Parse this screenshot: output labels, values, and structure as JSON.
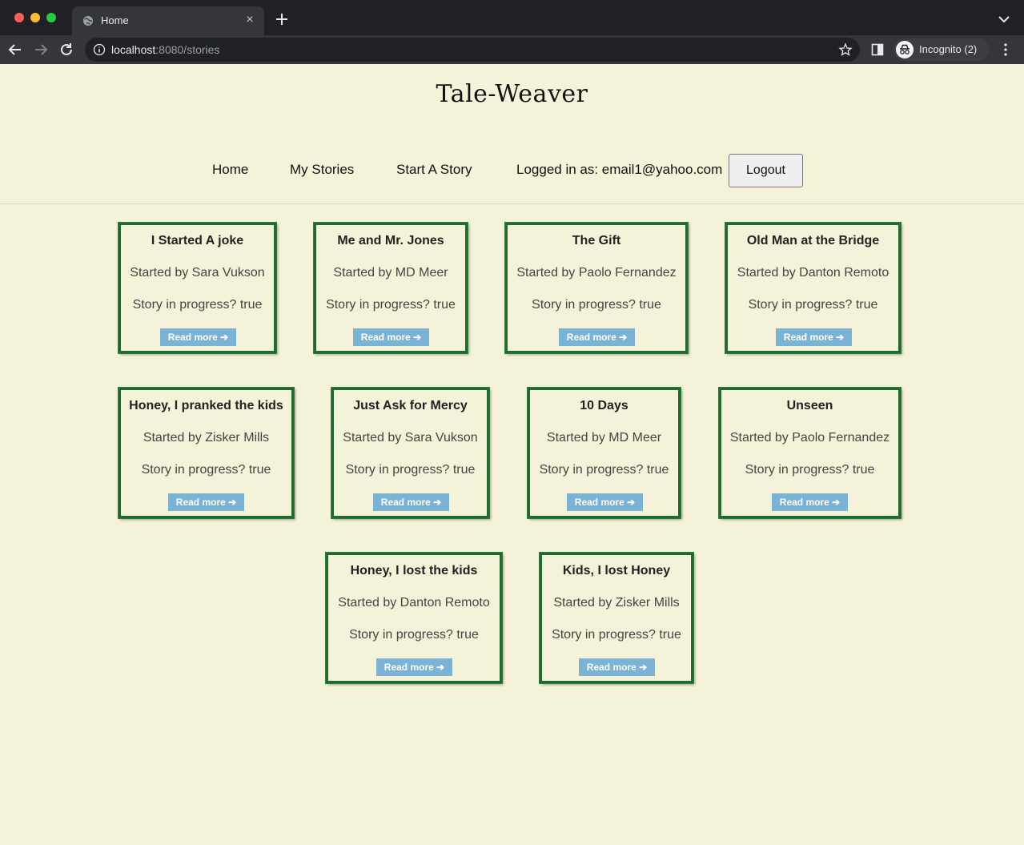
{
  "browser": {
    "tab_title": "Home",
    "tab_close": "×",
    "url_host": "localhost",
    "url_path": ":8080/stories",
    "profile_label": "Incognito (2)"
  },
  "site": {
    "logo": "Tale-Weaver",
    "nav": {
      "home": "Home",
      "my_stories": "My Stories",
      "start_story": "Start A Story",
      "logged_in": "Logged in as: email1@yahoo.com",
      "logout": "Logout"
    }
  },
  "stories": [
    {
      "title": "I Started A joke",
      "author": "Started by Sara Vukson",
      "progress": "Story in progress? true",
      "link": "Read more ➔"
    },
    {
      "title": "Me and Mr. Jones",
      "author": "Started by MD Meer",
      "progress": "Story in progress? true",
      "link": "Read more ➔"
    },
    {
      "title": "The Gift",
      "author": "Started by Paolo Fernandez",
      "progress": "Story in progress? true",
      "link": "Read more ➔"
    },
    {
      "title": "Old Man at the Bridge",
      "author": "Started by Danton Remoto",
      "progress": "Story in progress? true",
      "link": "Read more ➔"
    },
    {
      "title": "Honey, I pranked the kids",
      "author": "Started by Zisker Mills",
      "progress": "Story in progress? true",
      "link": "Read more ➔"
    },
    {
      "title": "Just Ask for Mercy",
      "author": "Started by Sara Vukson",
      "progress": "Story in progress? true",
      "link": "Read more ➔"
    },
    {
      "title": "10 Days",
      "author": "Started by MD Meer",
      "progress": "Story in progress? true",
      "link": "Read more ➔"
    },
    {
      "title": "Unseen",
      "author": "Started by Paolo Fernandez",
      "progress": "Story in progress? true",
      "link": "Read more ➔"
    },
    {
      "title": "Honey, I lost the kids",
      "author": "Started by Danton Remoto",
      "progress": "Story in progress? true",
      "link": "Read more ➔"
    },
    {
      "title": "Kids, I lost Honey",
      "author": "Started by Zisker Mills",
      "progress": "Story in progress? true",
      "link": "Read more ➔"
    }
  ]
}
